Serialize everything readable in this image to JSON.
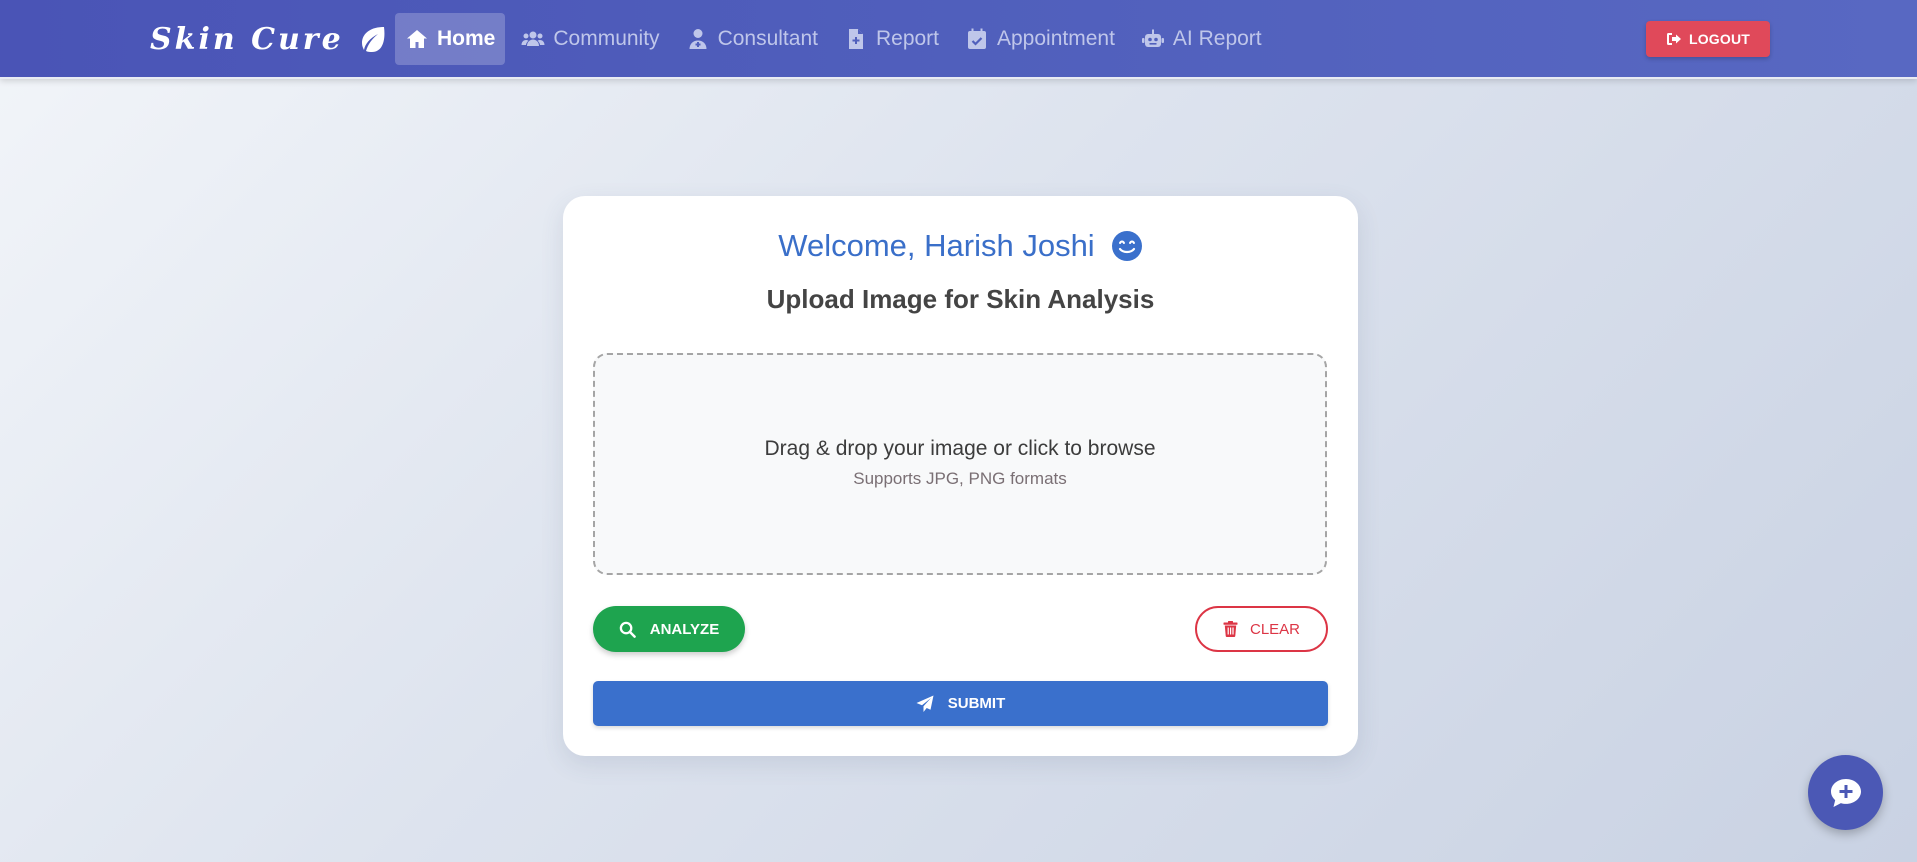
{
  "brand": {
    "name": "Skin Cure",
    "icon": "leaf-icon"
  },
  "nav": {
    "items": [
      {
        "label": "Home",
        "icon": "home-icon",
        "active": true
      },
      {
        "label": "Community",
        "icon": "users-icon",
        "active": false
      },
      {
        "label": "Consultant",
        "icon": "user-doctor-icon",
        "active": false
      },
      {
        "label": "Report",
        "icon": "file-medical-icon",
        "active": false
      },
      {
        "label": "Appointment",
        "icon": "calendar-check-icon",
        "active": false
      },
      {
        "label": "AI Report",
        "icon": "robot-icon",
        "active": false
      }
    ],
    "logout_label": "LOGOUT"
  },
  "card": {
    "welcome": "Welcome, Harish Joshi",
    "subtitle": "Upload Image for Skin Analysis",
    "dropzone": {
      "main": "Drag & drop your image or click to browse",
      "sub": "Supports JPG, PNG formats"
    },
    "analyze_label": "ANALYZE",
    "clear_label": "CLEAR",
    "submit_label": "SUBMIT"
  },
  "colors": {
    "nav_bg": "#4f5cba",
    "accent_blue": "#3a70cc",
    "analyze_green": "#1ea44f",
    "danger_red": "#dc3545",
    "logout_red": "#e0495a"
  }
}
